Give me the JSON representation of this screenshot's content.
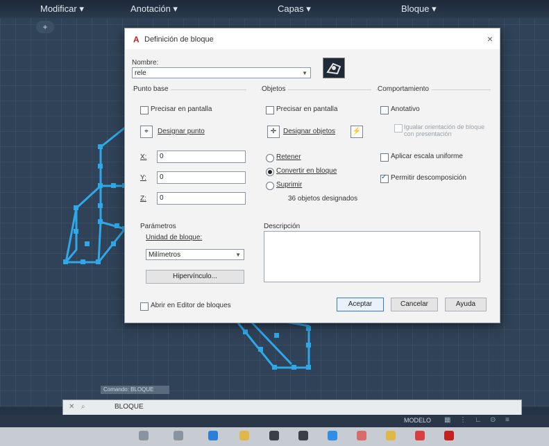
{
  "ribbon": {
    "modificar": "Modificar ▾",
    "anotacion": "Anotación ▾",
    "capas": "Capas ▾",
    "bloque": "Bloque ▾"
  },
  "canvas": {
    "nav_button": "+"
  },
  "dialog": {
    "title": "Definición de bloque",
    "close": "×",
    "nombre_label": "Nombre:",
    "nombre_value": "rele",
    "punto_base": {
      "heading": "Punto base",
      "precisar": "Precisar en pantalla",
      "designar_punto": "Designar punto",
      "x_label": "X:",
      "x_value": "0",
      "y_label": "Y:",
      "y_value": "0",
      "z_label": "Z:",
      "z_value": "0"
    },
    "objetos": {
      "heading": "Objetos",
      "precisar": "Precisar en pantalla",
      "designar_objetos": "Designar objetos",
      "retener": "Retener",
      "convertir": "Convertir en bloque",
      "suprimir": "Suprimir",
      "count": "36 objetos designados"
    },
    "comportamiento": {
      "heading": "Comportamiento",
      "anotativo": "Anotativo",
      "igualar": "Igualar orientación de bloque con presentación",
      "escala": "Aplicar escala uniforme",
      "descomposicion": "Permitir descomposición"
    },
    "parametros": {
      "heading": "Parámetros",
      "unidad_label": "Unidad de bloque:",
      "unidad_value": "Milímetros",
      "hipervinculo": "Hipervínculo..."
    },
    "descripcion": {
      "heading": "Descripción"
    },
    "abrir_editor": "Abrir en Editor de bloques",
    "aceptar": "Aceptar",
    "cancelar": "Cancelar",
    "ayuda": "Ayuda"
  },
  "command": {
    "history": "Comando: BLOQUE",
    "text": "BLOQUE"
  },
  "status": {
    "modelo": "MODELO"
  },
  "colors": {
    "geometry": "#2ea8e8",
    "dialog_bg": "#f3f3f3",
    "canvas_bg": "#2f4257"
  }
}
